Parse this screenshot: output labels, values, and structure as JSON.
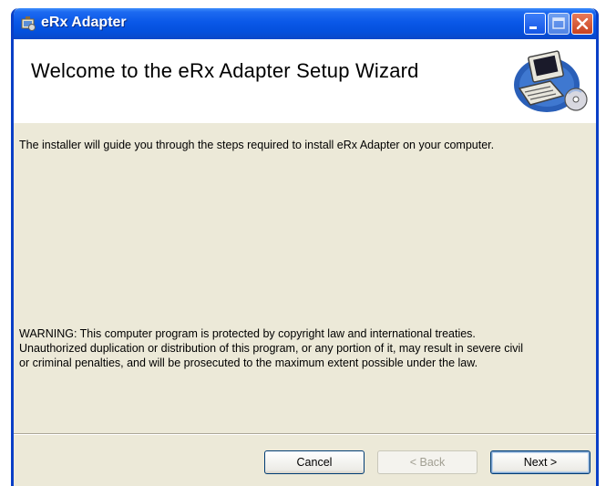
{
  "window": {
    "title": "eRx Adapter",
    "app_icon": "installer-icon"
  },
  "titlebar_buttons": {
    "minimize_icon": "minimize-icon",
    "maximize_icon": "maximize-icon",
    "close_icon": "close-icon"
  },
  "header": {
    "title": "Welcome to the eRx Adapter Setup Wizard",
    "art_icon": "computer-setup-icon"
  },
  "body": {
    "intro": "The installer will guide you through the steps required to install eRx Adapter on your computer.",
    "warning_lines": [
      "WARNING: This computer program is protected by copyright law and international treaties.",
      "Unauthorized duplication or distribution of this program, or any portion of it, may result in severe civil",
      "or criminal penalties, and will be prosecuted to the maximum extent possible under the law."
    ]
  },
  "buttons": {
    "cancel": "Cancel",
    "back": "< Back",
    "next": "Next >"
  },
  "colors": {
    "titlebar": "#0a58e8",
    "window_body": "#ece9d8",
    "close_button": "#c84220"
  }
}
